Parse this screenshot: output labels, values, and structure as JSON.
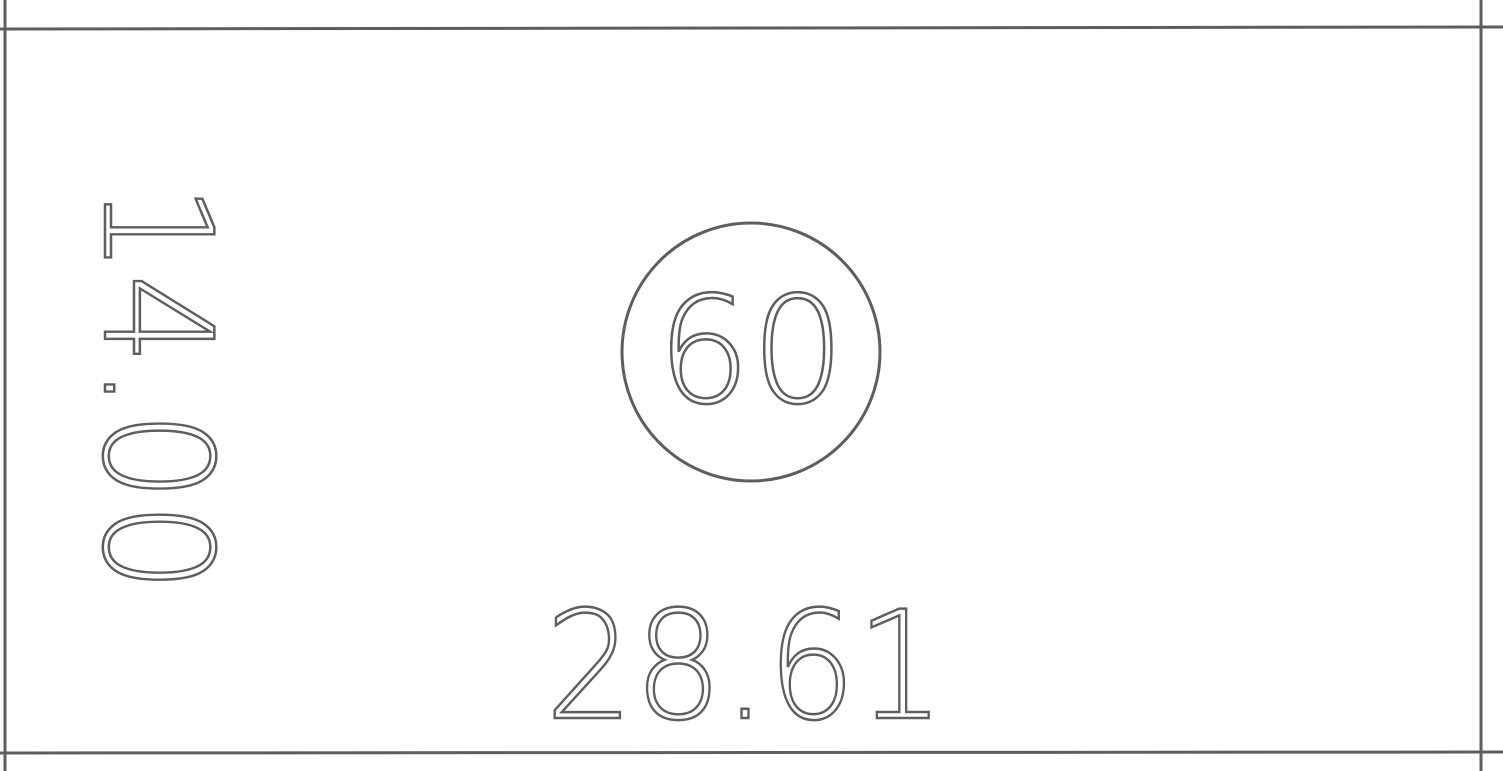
{
  "drawing": {
    "width_label": "28.61",
    "height_label": "14.00",
    "room_tag": "60",
    "line_color": "#5e5e5e",
    "background": "#ffffff"
  }
}
